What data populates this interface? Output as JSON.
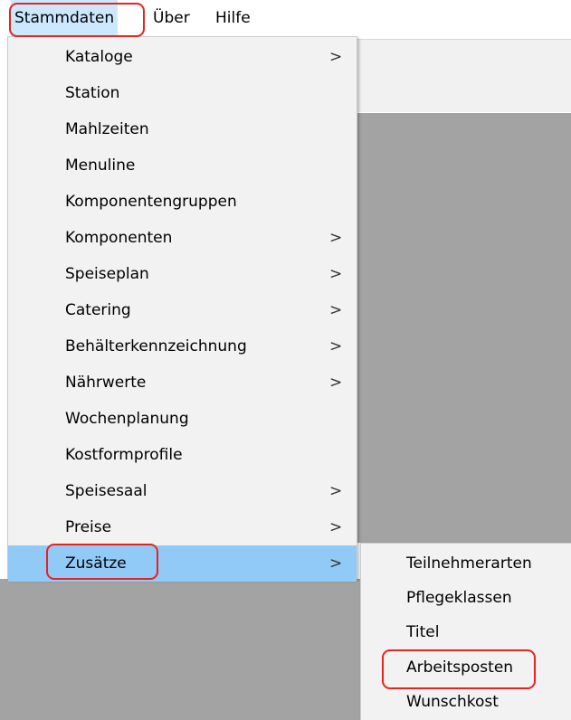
{
  "menubar": {
    "items": [
      {
        "label": "Stammdaten"
      },
      {
        "label": "Über"
      },
      {
        "label": "Hilfe"
      }
    ]
  },
  "dropdown": {
    "items": [
      {
        "label": "Kataloge",
        "has_submenu": true
      },
      {
        "label": "Station",
        "has_submenu": false
      },
      {
        "label": "Mahlzeiten",
        "has_submenu": false
      },
      {
        "label": "Menuline",
        "has_submenu": false
      },
      {
        "label": "Komponentengruppen",
        "has_submenu": false
      },
      {
        "label": "Komponenten",
        "has_submenu": true
      },
      {
        "label": "Speiseplan",
        "has_submenu": true
      },
      {
        "label": "Catering",
        "has_submenu": true
      },
      {
        "label": "Behälterkennzeichnung",
        "has_submenu": true
      },
      {
        "label": "Nährwerte",
        "has_submenu": true
      },
      {
        "label": "Wochenplanung",
        "has_submenu": false
      },
      {
        "label": "Kostformprofile",
        "has_submenu": false
      },
      {
        "label": "Speisesaal",
        "has_submenu": true
      },
      {
        "label": "Preise",
        "has_submenu": true
      },
      {
        "label": "Zusätze",
        "has_submenu": true,
        "active": true
      }
    ],
    "arrow_glyph": ">"
  },
  "submenu": {
    "items": [
      {
        "label": "Teilnehmerarten"
      },
      {
        "label": "Pflegeklassen"
      },
      {
        "label": "Titel"
      },
      {
        "label": "Arbeitsposten"
      },
      {
        "label": "Wunschkost"
      }
    ]
  },
  "colors": {
    "highlight_border": "#e8231d",
    "active_item_bg": "#91c9f7",
    "menu_bg": "#f2f2f2",
    "workspace_gray": "#a3a3a3"
  }
}
